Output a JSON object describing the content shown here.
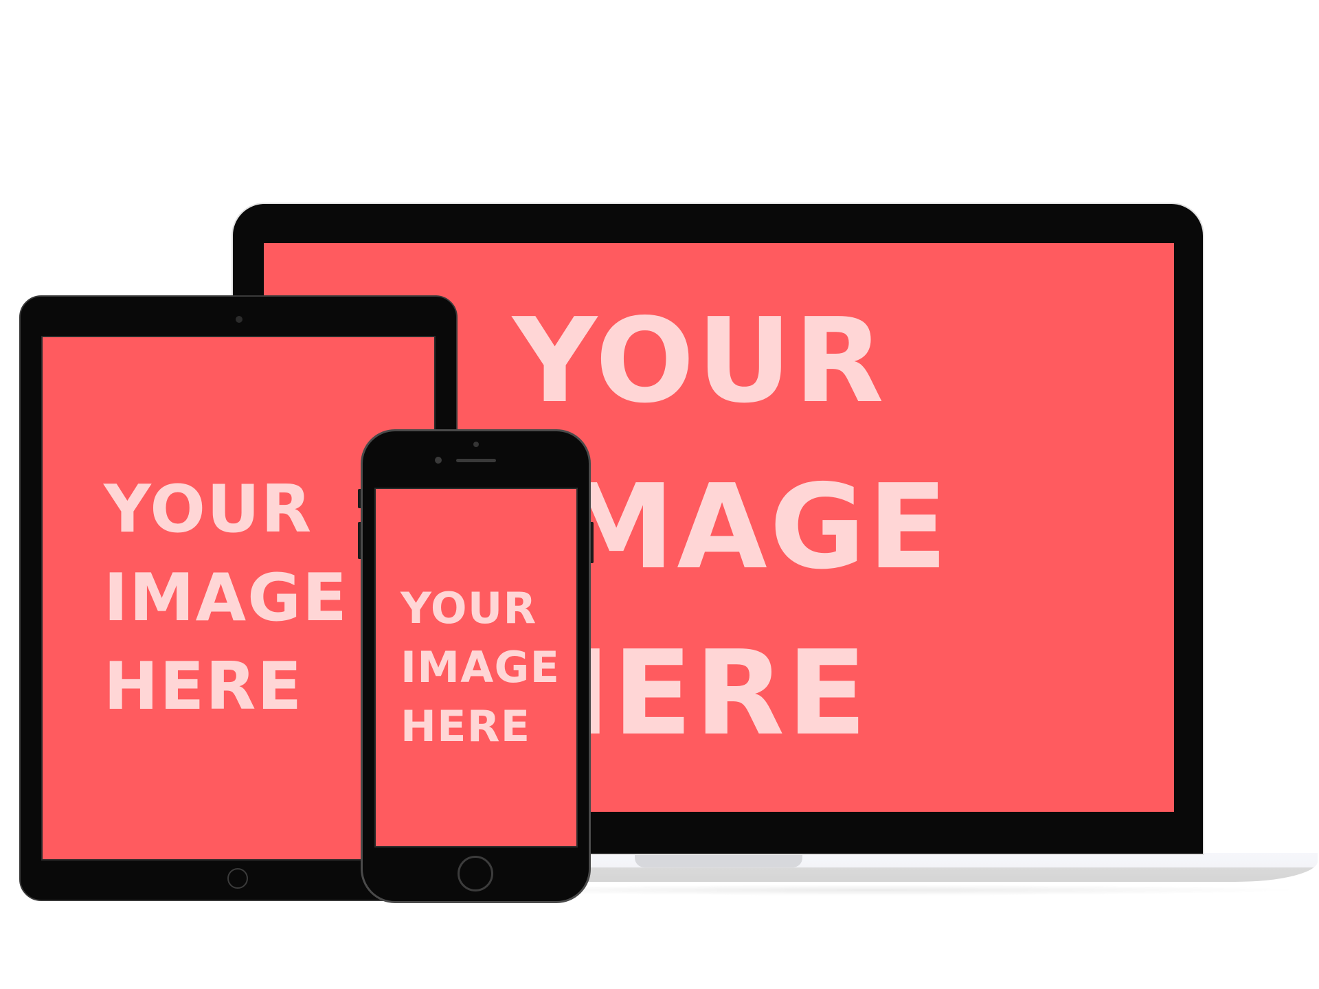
{
  "colors": {
    "screen": "#ff5b5f",
    "text": "#ffd6d6",
    "bezel": "#090909"
  },
  "laptop": {
    "lines": [
      "YOUR",
      "IMAGE",
      "HERE"
    ]
  },
  "tablet": {
    "lines": [
      "YOUR",
      "IMAGE",
      "HERE"
    ]
  },
  "phone": {
    "lines": [
      "YOUR",
      "IMAGE",
      "HERE"
    ]
  }
}
